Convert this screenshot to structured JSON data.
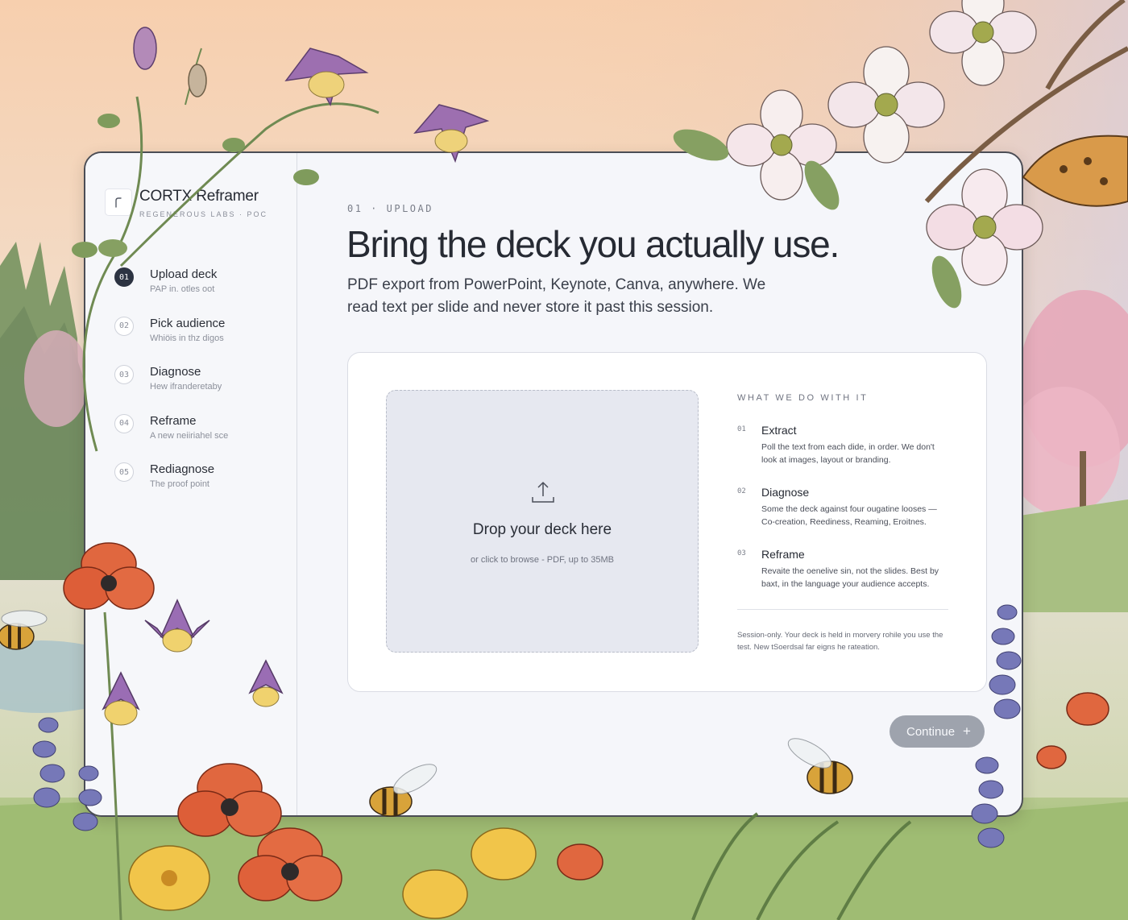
{
  "brand": {
    "name": "CORTX Reframer",
    "subtitle": "REGENEROUS LABS · POC",
    "logo_icon": "hook-logo-icon"
  },
  "steps": [
    {
      "num": "01",
      "title": "Upload deck",
      "sub": "PAP in. otles oot",
      "active": true
    },
    {
      "num": "02",
      "title": "Pick audience",
      "sub": "Whiöis in thz digos",
      "active": false
    },
    {
      "num": "03",
      "title": "Diagnose",
      "sub": "Hew ifranderetaby",
      "active": false
    },
    {
      "num": "04",
      "title": "Reframe",
      "sub": "A new neiiriahel sce",
      "active": false
    },
    {
      "num": "05",
      "title": "Rediagnose",
      "sub": "The proof point",
      "active": false
    }
  ],
  "main": {
    "eyebrow": "01 · UPLOAD",
    "headline": "Bring the deck you actually use.",
    "lede": "PDF export from PowerPoint, Keynote, Canva, anywhere. We read text per slide and never store it past this session."
  },
  "dropzone": {
    "icon": "upload-icon",
    "title": "Drop your deck here",
    "sub": "or click to browse - PDF, up to 35MB"
  },
  "info": {
    "heading": "WHAT WE DO WITH IT",
    "items": [
      {
        "num": "01",
        "title": "Extract",
        "desc": "Poll the text from each dide, in order. We don't look at images, layout or branding."
      },
      {
        "num": "02",
        "title": "Diagnose",
        "desc": "Some the deck against four ougatine looses — Co-creation, Reediness, Reaming, Eroitnes."
      },
      {
        "num": "03",
        "title": "Reframe",
        "desc": "Revaite the oenelive sin, not the slides. Best by baxt, in the language your audience accepts."
      }
    ],
    "note": "Session-only. Your deck is held in morvery rohile you use the test. New tSoerdsal far eigns he rateation."
  },
  "actions": {
    "continue_label": "Continue",
    "continue_icon": "plus-icon"
  },
  "colors": {
    "active_step": "#2c3342",
    "continue_button": "#9ea3ad",
    "dropzone": "#e6e8f0"
  }
}
